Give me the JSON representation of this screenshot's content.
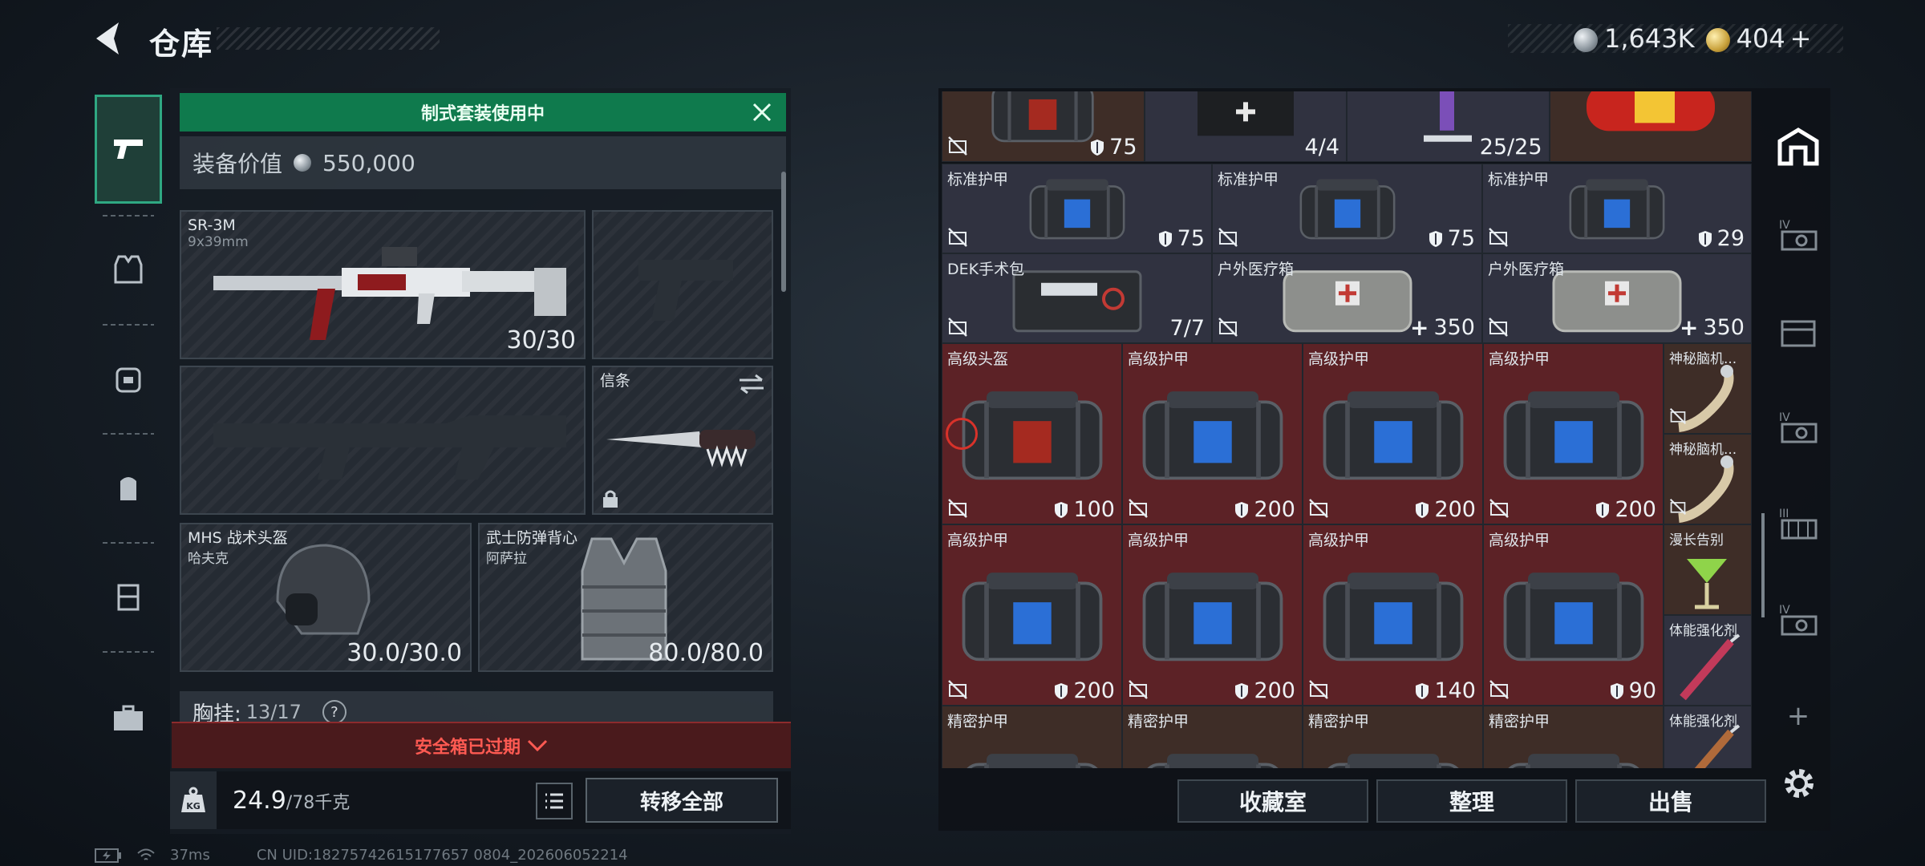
{
  "header": {
    "title": "仓库",
    "currency": [
      {
        "icon": "silver-coin-icon",
        "value": "1,643K"
      },
      {
        "icon": "gold-coin-icon",
        "value": "404"
      }
    ],
    "currency_add": "+"
  },
  "left_tabs": [
    "pistol-tab",
    "armor-vest-tab",
    "backpack-armor-tab",
    "backpack-tab",
    "chest-rig-tab",
    "toolbox-tab"
  ],
  "loadout": {
    "banner": "制式套装使用中",
    "equip_value_label": "装备价值",
    "equip_value": "550,000",
    "primary": {
      "name": "SR-3M",
      "caliber": "9x39mm",
      "ammo": "30/30"
    },
    "melee": {
      "name": "信条"
    },
    "helmet": {
      "name": "MHS 战术头盔",
      "sub": "哈夫克",
      "durability": "30.0/30.0"
    },
    "armor": {
      "name": "武士防弹背心",
      "sub": "阿萨拉",
      "durability": "80.0/80.0"
    },
    "chest_rig": {
      "label": "胸挂:",
      "value": "13/17",
      "help": "?"
    },
    "safebox": "安全箱已过期",
    "weight_icon_text": "KG",
    "weight_value": "24.9",
    "weight_max": "/78千克",
    "transfer_all": "转移全部"
  },
  "status": {
    "ping": "37ms",
    "uid": "CN UID:18275742615177657 0804_202606052214"
  },
  "warehouse": {
    "rows": [
      [
        {
          "name": "",
          "val": "75",
          "kind": "shield",
          "bg": "brown"
        },
        {
          "name": "",
          "val": "4/4",
          "kind": "count",
          "bg": "dark"
        },
        {
          "name": "",
          "val": "25/25",
          "kind": "count",
          "bg": "dark"
        },
        {
          "name": "",
          "val": "",
          "kind": "none",
          "bg": "brown"
        }
      ],
      [
        {
          "name": "标准护甲",
          "val": "75"
        },
        {
          "name": "标准护甲",
          "val": "75"
        },
        {
          "name": "标准护甲",
          "val": "29"
        }
      ],
      [
        {
          "name": "DEK手术包",
          "val": "7/7"
        },
        {
          "name": "户外医疗箱",
          "val": "350"
        },
        {
          "name": "户外医疗箱",
          "val": "350"
        }
      ],
      [
        {
          "name": "高级头盔",
          "val": "100"
        },
        {
          "name": "高级护甲",
          "val": "200"
        },
        {
          "name": "高级护甲",
          "val": "200"
        },
        {
          "name": "高级护甲",
          "val": "200"
        }
      ],
      [
        {
          "name": "高级护甲",
          "val": "200"
        },
        {
          "name": "高级护甲",
          "val": "200"
        },
        {
          "name": "高级护甲",
          "val": "140"
        },
        {
          "name": "高级护甲",
          "val": "90"
        }
      ],
      [
        {
          "name": "精密护甲"
        },
        {
          "name": "精密护甲"
        },
        {
          "name": "精密护甲"
        },
        {
          "name": "精密护甲"
        }
      ]
    ],
    "small_items": [
      "神秘脑机...",
      "神秘脑机...",
      "漫长告别",
      "体能强化剂",
      "体能强化剂"
    ],
    "buttons": {
      "collection": "收藏室",
      "organize": "整理",
      "sell": "出售"
    },
    "side_tabs": [
      "IV",
      "",
      "IV",
      "III",
      "IV"
    ],
    "add_tab": "+"
  },
  "colors": {
    "accent_green": "#0f7a4d",
    "alert_red": "#ff5a52",
    "cell_red": "#5c2226",
    "cell_dark": "#303240"
  }
}
